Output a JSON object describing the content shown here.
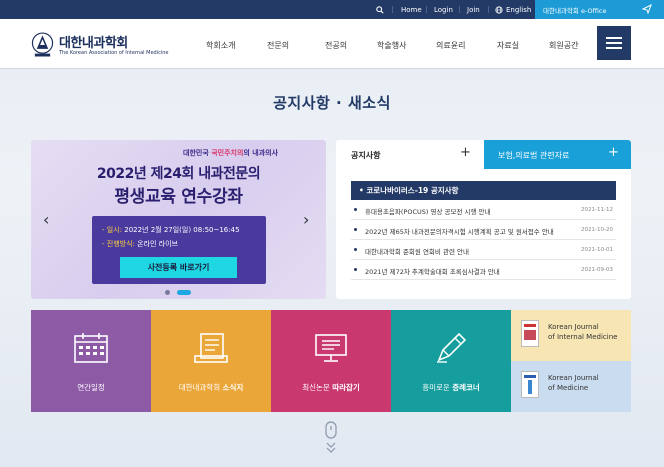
{
  "topbar": {
    "home": "Home",
    "login": "Login",
    "join": "Join",
    "english": "English",
    "eoffice": "대한내과학회 e-Office"
  },
  "logo": {
    "title": "대한내과학회",
    "subtitle": "The Korean Association of Internal Medicine"
  },
  "gnb": [
    "학회소개",
    "전문의",
    "전공의",
    "학술행사",
    "의료윤리",
    "자료실",
    "회원공간"
  ],
  "page_title": "공지사항 · 새소식",
  "banner": {
    "slogan_a": "대한민국",
    "slogan_b": "국민주치의",
    "slogan_c": "내과의사",
    "line1": "2022년 제24회 내과전문의",
    "line2": "평생교육 연수강좌",
    "date_label": "- 일시:",
    "date_value": "2022년 2월 27일(일) 08:50~16:45",
    "method_label": "- 진행방식:",
    "method_value": "온라인 라이브",
    "cta": "사전등록 바로가기",
    "prev": "‹",
    "next": "›"
  },
  "board": {
    "tab_notice": "공지사항",
    "tab_insurance": "보험,의료법 관련자료",
    "plus": "+",
    "highlight": "• 코로나바이러스-19 공지사항",
    "items": [
      {
        "title": "휴대용초음파(POCUS) 영상 공모전 시행 안내",
        "date": "2021-11-12"
      },
      {
        "title": "2022년 제65차 내과전문의자격시험 시행계획 공고 및 원서접수 안내",
        "date": "2021-10-20"
      },
      {
        "title": "대한내과학회 준회원 연회비 관련 안내",
        "date": "2021-10-01"
      },
      {
        "title": "2021년 제72차 추계학술대회 초록심사결과 안내",
        "date": "2021-09-03"
      }
    ]
  },
  "tiles": [
    {
      "pre": "연간일정",
      "bold": "",
      "color": "#8d5aa6"
    },
    {
      "pre": "대한내과학회 ",
      "bold": "소식지",
      "color": "#eba63a"
    },
    {
      "pre": "최신논문 ",
      "bold": "따라잡기",
      "color": "#c9386f"
    },
    {
      "pre": "흥미로운 ",
      "bold": "증례코너",
      "color": "#169e9e"
    }
  ],
  "journals": [
    {
      "line1": "Korean Journal",
      "line2": "of Internal Medicine",
      "bg": "#f7e6b3"
    },
    {
      "line1": "Korean Journal",
      "line2": "of Medicine",
      "bg": "#c9dcf0"
    }
  ]
}
